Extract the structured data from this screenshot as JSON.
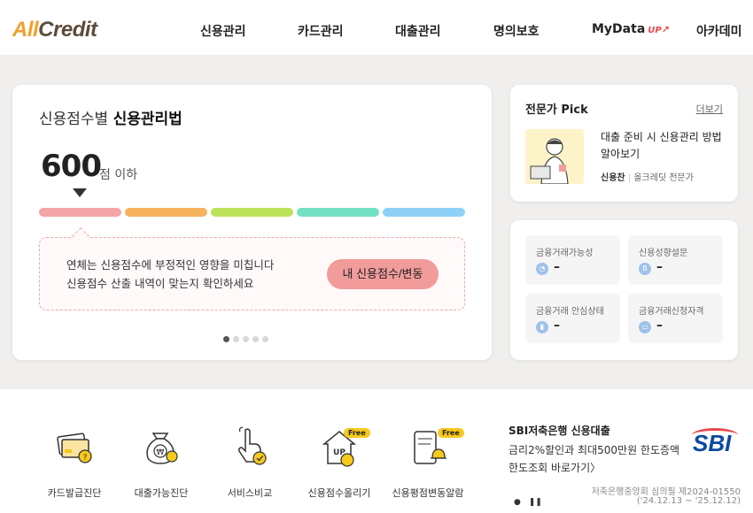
{
  "header": {
    "logo_all": "All",
    "logo_credit": "Credit",
    "nav": [
      "신용관리",
      "카드관리",
      "대출관리",
      "명의보호",
      "MyData",
      "아카데미"
    ],
    "mydata_badge": "UP"
  },
  "score_card": {
    "title_prefix": "신용점수별",
    "title_bold": "신용관리법",
    "score": "600",
    "score_unit": "점 이하",
    "bar_colors": [
      "#f3a4a6",
      "#f6b15e",
      "#bde35a",
      "#74e2c2",
      "#8fd1f6"
    ],
    "active_segment": 0,
    "notice_line1": "연체는 신용점수에 부정적인 영향을 미칩니다",
    "notice_line2": "신용점수 산출 내역이 맞는지 확인하세요",
    "button": "내 신용점수/변동",
    "pager_total": 5,
    "pager_active": 0
  },
  "expert": {
    "title": "전문가 Pick",
    "more": "더보기",
    "article_title": "대출 준비 시 신용관리 방법 알아보기",
    "author": "신용찬",
    "author_role": "올크레딧 전문가"
  },
  "status": [
    {
      "label": "금융거래가능성",
      "value": "–",
      "icon": "chart-icon"
    },
    {
      "label": "신용성향설문",
      "value": "–",
      "icon": "survey-icon"
    },
    {
      "label": "금융거래 안심상태",
      "value": "–",
      "icon": "bar-icon"
    },
    {
      "label": "금융거래신청자격",
      "value": "–",
      "icon": "card-icon"
    }
  ],
  "services": [
    {
      "label": "카드발급진단",
      "icon": "card-diagnosis-icon",
      "free": false
    },
    {
      "label": "대출가능진단",
      "icon": "money-bag-icon",
      "free": false
    },
    {
      "label": "서비스비교",
      "icon": "hand-tap-icon",
      "free": false
    },
    {
      "label": "신용점수올리기",
      "icon": "house-up-icon",
      "free": true
    },
    {
      "label": "신용평점변동알람",
      "icon": "phone-alarm-icon",
      "free": true
    }
  ],
  "free_label": "Free",
  "ad": {
    "title": "SBI저축은행 신용대출",
    "line1": "금리2%할인과 최대500만원 한도증액",
    "line2": "한도조회 바로가기〉",
    "logo": "SBI",
    "note1": "저축은행중앙회 심의필 제2024-01550",
    "note2": "('24.12.13 ~ '25.12.12)",
    "brand_color": "#0b4aa2"
  }
}
